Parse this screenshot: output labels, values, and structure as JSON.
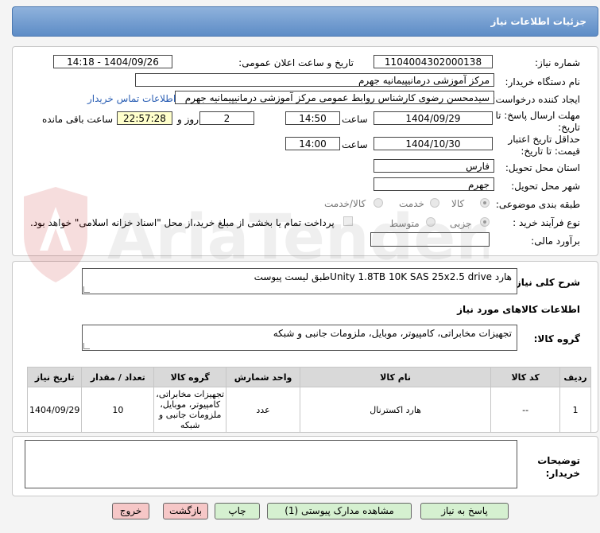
{
  "header": {
    "title": "جزئیات اطلاعات نیاز"
  },
  "form": {
    "need_number_label": "شماره نیاز:",
    "need_number": "1104004302000138",
    "announce_label": "تاریخ و ساعت اعلان عمومی:",
    "announce_value": "1404/09/26 - 14:18",
    "buyer_org_label": "نام دستگاه خریدار:",
    "buyer_org": "مرکز آموزشی درمانیپیمانیه جهرم",
    "creator_label": "ایجاد کننده درخواست:",
    "creator": "سیدمحسن رضوی کارشناس روابط عمومی مرکز آموزشی درمانیپیمانیه جهرم",
    "contact_link": "اطلاعات تماس خریدار",
    "deadline_label_1": "مهلت ارسال پاسخ: تا",
    "deadline_label_2": "تاریخ:",
    "deadline_date": "1404/09/29",
    "time_label": "ساعت",
    "deadline_time": "14:50",
    "days_value": "2",
    "days_label": "روز و",
    "remaining_time": "22:57:28",
    "remaining_label": "ساعت باقی مانده",
    "validity_label_1": "حداقل تاریخ اعتبار",
    "validity_label_2": "قیمت: تا تاریخ:",
    "validity_date": "1404/10/30",
    "validity_time_label": "ساعت",
    "validity_time": "14:00",
    "province_label": "استان محل تحویل:",
    "province": "فارس",
    "city_label": "شهر محل تحویل:",
    "city": "جهرم",
    "category_label": "طبقه بندی موضوعی:",
    "category_options": [
      "کالا",
      "خدمت",
      "کالا/خدمت"
    ],
    "purchase_type_label": "نوع فرآیند خرید :",
    "purchase_options": [
      "جزیی",
      "متوسط"
    ],
    "payment_note": "پرداخت تمام یا بخشی از مبلغ خرید،از محل \"اسناد خزانه اسلامی\" خواهد بود.",
    "estimate_label": "برآورد مالی:",
    "estimate_value": ""
  },
  "description": {
    "label": "شرح کلی نیاز:",
    "text": "هارد  Unity 1.8TB 10K SAS 25x2.5 driveطبق لیست پیوست"
  },
  "goods_section": {
    "title": "اطلاعات کالاهای مورد نیاز",
    "group_label": "گروه کالا:",
    "group_value": "تجهیزات مخابراتی، کامپیوتر، موبایل، ملزومات جانبی و شبکه"
  },
  "table": {
    "headers": [
      "ردیف",
      "کد کالا",
      "نام کالا",
      "واحد شمارش",
      "گروه کالا",
      "تعداد / مقدار",
      "تاریخ نیاز"
    ],
    "rows": [
      {
        "row": "1",
        "code": "--",
        "name": "هارد اکسترنال",
        "unit": "عدد",
        "group": "تجهیزات مخابراتی، کامپیوتر، موبایل، ملزومات جانبی و شبکه",
        "qty": "10",
        "date": "1404/09/29"
      }
    ]
  },
  "buyer_notes": {
    "label_1": "توضیحات",
    "label_2": "خریدار:",
    "value": ""
  },
  "buttons": {
    "reply": "پاسخ به نیاز",
    "view_docs": "مشاهده مدارک پیوستی (1)",
    "print": "چاپ",
    "back": "بازگشت",
    "exit": "خروج"
  },
  "watermark": "AriaTender.neT",
  "colors": {
    "header": "#6b95cb",
    "time_highlight": "#ffffcc",
    "green_button": "#d5f0d0",
    "pink_button": "#f6c7c7",
    "link": "#2b5fb4"
  }
}
